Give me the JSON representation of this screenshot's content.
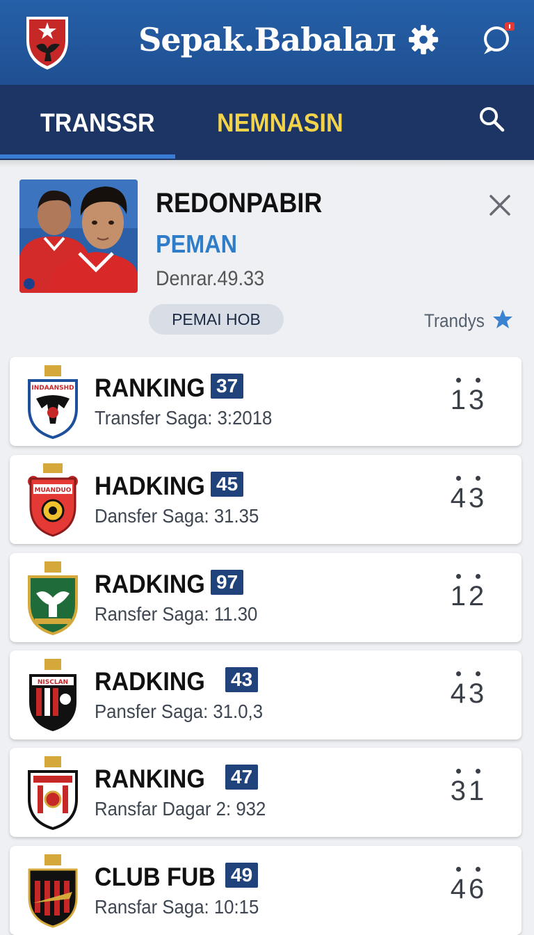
{
  "header": {
    "title": "Sepak.Babalaл",
    "notification_color": "#e53935"
  },
  "tabs": [
    {
      "label": "TRANSSR",
      "active": true
    },
    {
      "label": "NEMNASIN",
      "active": false
    }
  ],
  "featured": {
    "name": "REDONPABIR",
    "role": "PEMAN",
    "date": "Denrar.49.33",
    "pill_label": "PEMAI HOB",
    "trend_label": "Trandys"
  },
  "rankings": [
    {
      "title": "RANKING",
      "badge": "37",
      "subtitle": "Transfer Saga: 3:2018",
      "score": "13",
      "crest_color": "#1e4f9c",
      "crest_label": "INDAANSHD"
    },
    {
      "title": "HADKING",
      "badge": "45",
      "subtitle": "Dansfer Saga: 31.35",
      "score": "43",
      "crest_color": "#d32f2f",
      "crest_label": "MUANDUO"
    },
    {
      "title": "RADKING",
      "badge": "97",
      "subtitle": "Ransfer Saga: 11.30",
      "score": "12",
      "crest_color": "#1f6b3a",
      "crest_label": ""
    },
    {
      "title": "RADKING",
      "badge": "43",
      "subtitle": "Pansfer Saga: 31.0,3",
      "score": "43",
      "crest_color": "#c62828",
      "crest_label": "NISCLAN"
    },
    {
      "title": "RANKING",
      "badge": "47",
      "subtitle": "Ransfar Dagar 2: 932",
      "score": "31",
      "crest_color": "#c62828",
      "crest_label": ""
    },
    {
      "title": "CLUB FUB",
      "badge": "49",
      "subtitle": "Ransfar Saga: 10:15",
      "score": "46",
      "crest_color": "#111111",
      "crest_label": ""
    }
  ]
}
